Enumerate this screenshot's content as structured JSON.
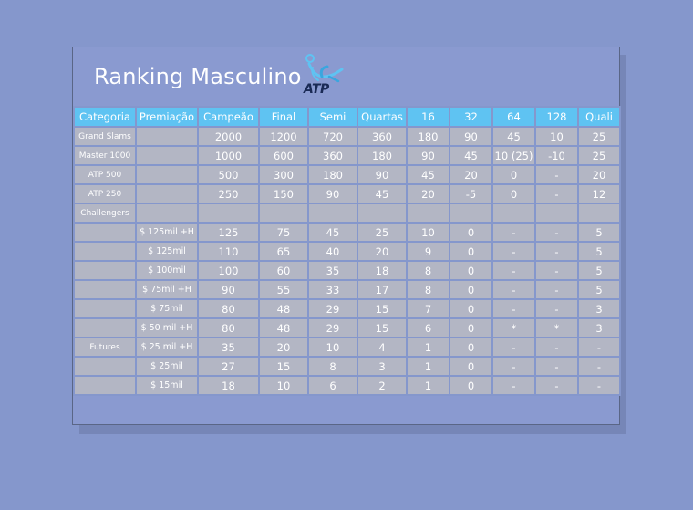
{
  "title": "Ranking Masculino",
  "logo": {
    "text": "ATP",
    "icon": "atp-player-logo-icon"
  },
  "colors": {
    "background": "#8597cc",
    "header": "#5fc3f2",
    "cell": "#b3b6c4"
  },
  "table": {
    "headers": [
      "Categoria",
      "Premiação",
      "Campeão",
      "Final",
      "Semi",
      "Quartas",
      "16",
      "32",
      "64",
      "128",
      "Quali"
    ],
    "rows": [
      [
        "Grand Slams",
        "",
        "2000",
        "1200",
        "720",
        "360",
        "180",
        "90",
        "45",
        "10",
        "25"
      ],
      [
        "Master 1000",
        "",
        "1000",
        "600",
        "360",
        "180",
        "90",
        "45",
        "10 (25)",
        "-10",
        "25"
      ],
      [
        "ATP 500",
        "",
        "500",
        "300",
        "180",
        "90",
        "45",
        "20",
        "0",
        "-",
        "20"
      ],
      [
        "ATP 250",
        "",
        "250",
        "150",
        "90",
        "45",
        "20",
        "-5",
        "0",
        "-",
        "12"
      ],
      [
        "Challengers",
        "",
        "",
        "",
        "",
        "",
        "",
        "",
        "",
        "",
        ""
      ],
      [
        "",
        "$ 125mil +H",
        "125",
        "75",
        "45",
        "25",
        "10",
        "0",
        "-",
        "-",
        "5"
      ],
      [
        "",
        "$ 125mil",
        "110",
        "65",
        "40",
        "20",
        "9",
        "0",
        "-",
        "-",
        "5"
      ],
      [
        "",
        "$ 100mil",
        "100",
        "60",
        "35",
        "18",
        "8",
        "0",
        "-",
        "-",
        "5"
      ],
      [
        "",
        "$ 75mil +H",
        "90",
        "55",
        "33",
        "17",
        "8",
        "0",
        "-",
        "-",
        "5"
      ],
      [
        "",
        "$ 75mil",
        "80",
        "48",
        "29",
        "15",
        "7",
        "0",
        "-",
        "-",
        "3"
      ],
      [
        "",
        "$ 50 mil +H",
        "80",
        "48",
        "29",
        "15",
        "6",
        "0",
        "*",
        "*",
        "3"
      ],
      [
        "Futures",
        "$ 25 mil +H",
        "35",
        "20",
        "10",
        "4",
        "1",
        "0",
        "-",
        "-",
        "-"
      ],
      [
        "",
        "$ 25mil",
        "27",
        "15",
        "8",
        "3",
        "1",
        "0",
        "-",
        "-",
        "-"
      ],
      [
        "",
        "$ 15mil",
        "18",
        "10",
        "6",
        "2",
        "1",
        "0",
        "-",
        "-",
        "-"
      ]
    ]
  }
}
